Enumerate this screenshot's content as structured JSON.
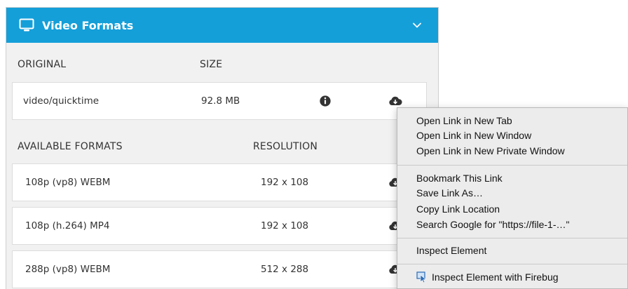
{
  "panel": {
    "title": "Video Formats",
    "icons": {
      "header": "monitor-icon",
      "collapse": "chevron-down-icon"
    },
    "colors": {
      "header_bg": "#149fd9"
    }
  },
  "original": {
    "headers": [
      "ORIGINAL",
      "SIZE"
    ],
    "row": {
      "type": "video/quicktime",
      "size": "92.8 MB"
    }
  },
  "available": {
    "headers": [
      "AVAILABLE FORMATS",
      "RESOLUTION"
    ],
    "rows": [
      {
        "format": "108p (vp8) WEBM",
        "resolution": "192 x 108"
      },
      {
        "format": "108p (h.264) MP4",
        "resolution": "192 x 108"
      },
      {
        "format": "288p (vp8) WEBM",
        "resolution": "512 x 288"
      }
    ]
  },
  "context_menu": {
    "items": [
      "Open Link in New Tab",
      "Open Link in New Window",
      "Open Link in New Private Window",
      "Bookmark This Link",
      "Save Link As…",
      "Copy Link Location",
      "Search Google for \"https://file-1-…\"",
      "Inspect Element",
      "Inspect Element with Firebug"
    ]
  }
}
